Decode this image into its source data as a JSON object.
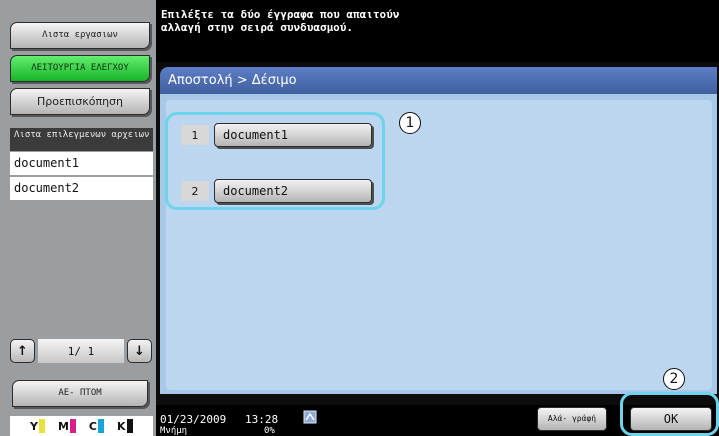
{
  "sidebar": {
    "job_list_label": "Λιστα εργασιων",
    "check_function_label": "ΛΕΙΤΟΥΡΓΙΑ ΕΛΕΓΧΟΥ",
    "preview_label": "Προεπισκόπηση",
    "selected_files_header": "Λιστα επιλεγμενων αρχειων",
    "selected_files": [
      "document1",
      "document2"
    ],
    "pager": {
      "up_icon": "arrow-up-icon",
      "down_icon": "arrow-down-icon",
      "page_text": "1/ 1"
    },
    "close_label": "ΑΕ- ΠΤΟΜ",
    "toner": [
      {
        "letter": "Y",
        "color": "#e8e23a"
      },
      {
        "letter": "M",
        "color": "#d6218a"
      },
      {
        "letter": "C",
        "color": "#1aa5d8"
      },
      {
        "letter": "K",
        "color": "#111111"
      }
    ]
  },
  "message": {
    "line1": "Επιλέξτε τα δύο έγγραφα που απαιτούν",
    "line2": "αλλαγή στην σειρά συνδυασμού."
  },
  "panel": {
    "breadcrumb": "Αποστολή > Δέσιμο",
    "documents": [
      {
        "number": "1",
        "name": "document1"
      },
      {
        "number": "2",
        "name": "document2"
      }
    ]
  },
  "callouts": [
    "1",
    "2"
  ],
  "status": {
    "date": "01/23/2009",
    "time": "13:28",
    "memory_label": "Μνήμη",
    "memory_value": "0%",
    "network_icon": "network-icon"
  },
  "footer": {
    "replace_label": "Αλά- γράφή",
    "ok_label": "OK"
  }
}
